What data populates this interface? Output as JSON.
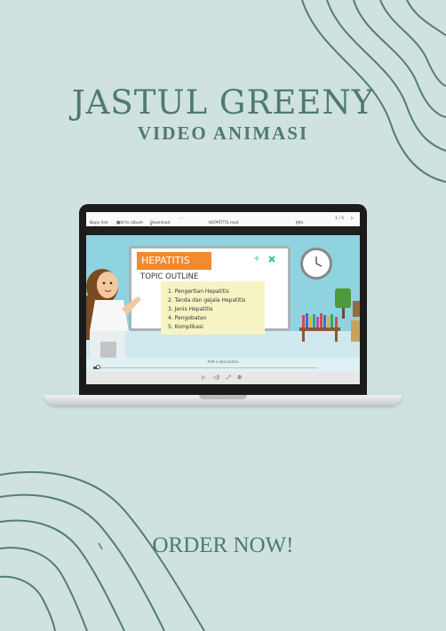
{
  "headline": "JASTUL GREENY",
  "subheadline": "VIDEO ANIMASI",
  "cta": "ORDER NOW!",
  "viewer": {
    "copy_link": "Copy link",
    "add_to_album": "Add to album",
    "download": "Download",
    "more": "···",
    "file_name": "HEPATITIS.mp4",
    "info": "Info",
    "page_counter": "1 / 5",
    "caption_placeholder": "Add a description"
  },
  "slide": {
    "tag": "HEPATITIS",
    "heading": "TOPIC OUTLINE",
    "items": [
      "1. Pengertian Hepatitis",
      "2. Tanda dan gejala Hepatitis",
      "3. Jenis Hepatitis",
      "4. Pengobatan",
      "5. Komplikasi"
    ]
  },
  "playback": {
    "progress": 0.02
  },
  "colors": {
    "background": "#cfe2df",
    "accent_text": "#4f7a6c",
    "slide_tag": "#f28a2e"
  }
}
